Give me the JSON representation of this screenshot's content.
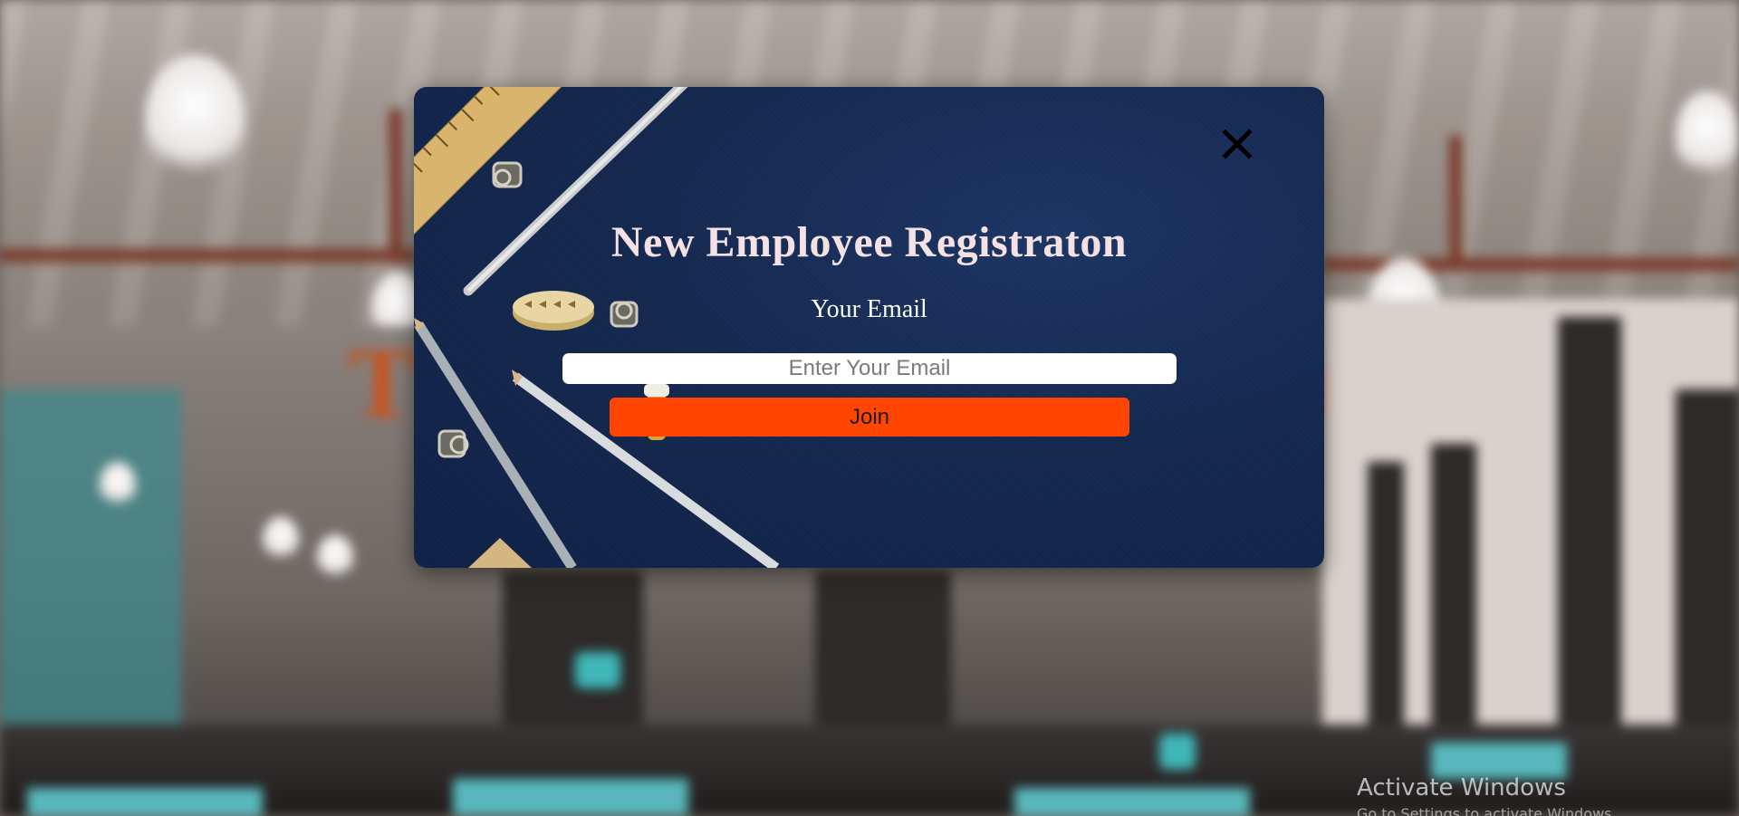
{
  "modal": {
    "title": "New Employee Registraton",
    "email_label": "Your Email",
    "email_placeholder": "Enter Your Email",
    "email_value": "",
    "join_label": "Join",
    "close_icon": "close-icon"
  },
  "overlay": {
    "watermark": "Activate Windows",
    "watermark_sub": "Go to Settings to activate Windows."
  },
  "colors": {
    "modal_background": "#14284f",
    "title_text": "#f3e1e4",
    "join_button": "#ff4500",
    "input_background": "#ffffff"
  }
}
